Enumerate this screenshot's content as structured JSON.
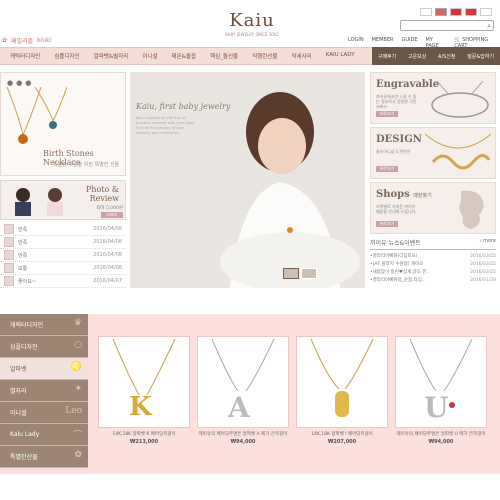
{
  "brand": {
    "logo": "Kaiu",
    "tagline": "BABY JEWELRY SINCE 2002",
    "family_link": "패밀리몰",
    "family_link2": "kiuki"
  },
  "search": {
    "placeholder": ""
  },
  "top_links": [
    "LOGIN",
    "MEMBER",
    "GUIDE",
    "MY PAGE",
    "SHOPPING CART"
  ],
  "main_nav": [
    "캐릭터디자인",
    "심플디자인",
    "알파벳&별자리",
    "이니셜",
    "태몬&돌잡",
    "핵심_돌선물",
    "직행런선물",
    "악세사리",
    "KAIU LADY"
  ],
  "sub_nav": [
    "구매후기",
    "고운보상",
    "A/S신청",
    "질문&답하기"
  ],
  "birth": {
    "title": "Birth Stones Necklace",
    "subtitle": "특별한 사람을 위한 특별한 선물"
  },
  "photo_review": {
    "title1": "Photo &",
    "title2": "Review",
    "caption": "최대 5,000원",
    "button": "더보기"
  },
  "reviews": [
    {
      "title": "만족",
      "date": "2016/04/08"
    },
    {
      "title": "만족",
      "date": "2016/04/08"
    },
    {
      "title": "만족",
      "date": "2016/04/08"
    },
    {
      "title": "보통",
      "date": "2016/04/08"
    },
    {
      "title": "좋아요~",
      "date": "2016/04/07"
    }
  ],
  "hero": {
    "title": "Kaiu, first baby jewelry",
    "body": "Kaiu's jewelry for the first of precious moment with your baby. It is the first jewelry of love, memory and celebration."
  },
  "promos": [
    {
      "heading": "Engravable",
      "sub": "까이유에서만 느낄 수 있는 정교하고 정밀한 각인서비스",
      "button": "바로가기"
    },
    {
      "heading": "DESIGN",
      "sub": "골드아니샵 도전하안",
      "button": "바로가기"
    },
    {
      "heading": "Shops",
      "heading_sub": "매장찾기",
      "sub": "지역별로 가까운 까이유 매장을 안내해 드립니다.",
      "button": "바로가기"
    }
  ],
  "news": {
    "title": "까이유 뉴스&이벤트",
    "more": "more",
    "items": [
      {
        "title": "결라리아빠화(디딤토요)",
        "date": "2016/03/25"
      },
      {
        "title": "[AF,플라지 수원점] 개이오",
        "date": "2016/03/25"
      },
      {
        "title": "새봄맞이 알린♥상세,글도 전..",
        "date": "2016/03/25"
      },
      {
        "title": "결라리아빠화점_순칭,타임..",
        "date": "2016/01/29"
      }
    ]
  },
  "categories": [
    {
      "label": "캐릭터디자인",
      "deco": "♛"
    },
    {
      "label": "심플디자인",
      "deco": "○"
    },
    {
      "label": "알파벳",
      "deco": "♌"
    },
    {
      "label": "별자리",
      "deco": "✦"
    },
    {
      "label": "이니셜",
      "deco": "Leo"
    },
    {
      "label": "Kalu Lady",
      "deco": "⌒"
    },
    {
      "label": "특별한선물",
      "deco": "✿"
    }
  ],
  "products": [
    {
      "name": "14K,18K 알파벳 K 페어딩목걸이",
      "price": "₩213,000"
    },
    {
      "name": "레이유의 페어딩주얼은 알파벳 A 메가 은목걸이",
      "price": "₩94,000"
    },
    {
      "name": "14K,18K 알파벳 I 페어딩목걸이",
      "price": "₩207,000"
    },
    {
      "name": "레이유의 페어딩주얼은 알파벳 U 메가 은목걸이",
      "price": "₩94,000"
    }
  ],
  "colors": {
    "accent": "#f5ddd8",
    "dark_brown": "#6b5648",
    "category_bg": "#9c8574"
  }
}
